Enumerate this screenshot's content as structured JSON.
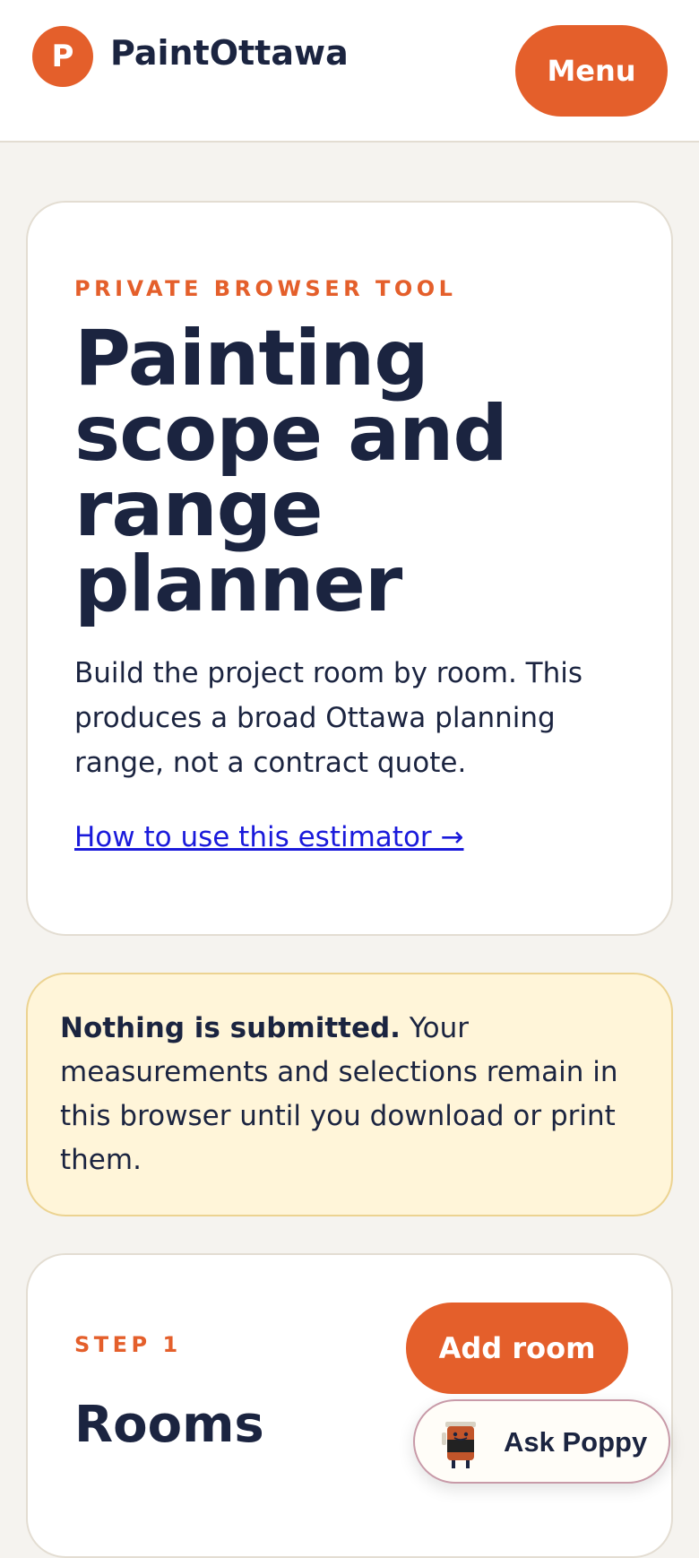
{
  "header": {
    "logo_letter": "P",
    "brand": "PaintOttawa",
    "menu_label": "Menu"
  },
  "hero": {
    "eyebrow": "PRIVATE BROWSER TOOL",
    "title": "Painting scope and range planner",
    "description": "Build the project room by room. This produces a broad Ottawa planning range, not a contract quote.",
    "link": "How to use this estimator →"
  },
  "notice": {
    "bold": "Nothing is submitted.",
    "text": " Your measurements and selections remain in this browser until you download or print them."
  },
  "step1": {
    "eyebrow": "STEP 1",
    "title": "Rooms",
    "add_button": "Add room"
  },
  "assistant": {
    "label": "Ask Poppy",
    "icon": "paint-can-mascot-icon"
  },
  "colors": {
    "accent": "#e45f2b",
    "text": "#1b2440",
    "notice_bg": "#fff5d9",
    "page_bg": "#f5f3ef",
    "link": "#1a1adb"
  }
}
